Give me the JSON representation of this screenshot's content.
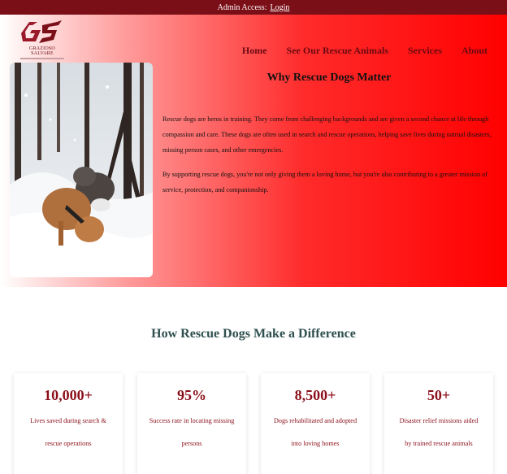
{
  "admin": {
    "label": "Admin Access:",
    "login": "Login"
  },
  "logo": {
    "initials": "GS",
    "name": "GRAZIOSO SALVARE"
  },
  "nav": {
    "items": [
      {
        "label": "Home"
      },
      {
        "label": "See Our Rescue Animals"
      },
      {
        "label": "Services"
      },
      {
        "label": "About"
      }
    ]
  },
  "hero": {
    "title": "Why Rescue Dogs Matter",
    "paragraphs": [
      "Rescue dogs are heros in training. They come from challenging backgrounds and are given a second chance at life through compassion and care. These dogs are often used in search and rescue operations, helping save lives during natrual disasters, missing person cases, and other emergencies.",
      "By supporting rescue dogs, you're not only giving them a loving home, but you're also contributing to a greater mission of service, protection, and companionship."
    ]
  },
  "difference": {
    "title": "How Rescue Dogs Make a Difference",
    "stats": [
      {
        "value": "10,000+",
        "desc": "Lives saved during search & rescue operations"
      },
      {
        "value": "95%",
        "desc": "Success rate in locating missing persons"
      },
      {
        "value": "8,500+",
        "desc": "Dogs rehabilitated and adopted into loving homes"
      },
      {
        "value": "50+",
        "desc": "Disaster relief missions aided by trained rescue animals"
      }
    ]
  },
  "colors": {
    "admin_bar": "#7a0f17",
    "brand": "#6a0a12",
    "accent": "#8b0f1a",
    "heading_teal": "#2f4f4f"
  }
}
